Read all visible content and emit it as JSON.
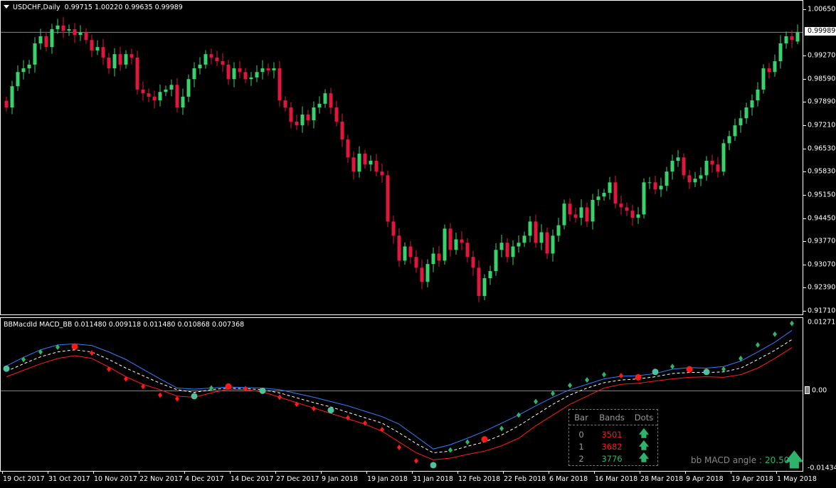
{
  "price_header": {
    "symbol": "USDCHF,Daily",
    "ohlc": "0.99715 1.00220 0.99635 0.99989"
  },
  "indicator_header": {
    "text": "BBMacdId MACD_BB 0.011480 0.009118 0.011480 0.010868 0.007368"
  },
  "price_axis": {
    "labels": [
      "1.00650",
      "0.99270",
      "0.98590",
      "0.97890",
      "0.97210",
      "0.96530",
      "0.95830",
      "0.95150",
      "0.94450",
      "0.93770",
      "0.93070",
      "0.92390",
      "0.91710"
    ],
    "current": "0.99989"
  },
  "indicator_axis": {
    "top": "0.01271",
    "zero": "0.00",
    "bottom": "-0.014341"
  },
  "time_axis": {
    "labels": [
      "19 Oct 2017",
      "31 Oct 2017",
      "10 Nov 2017",
      "22 Nov 2017",
      "4 Dec 2017",
      "14 Dec 2017",
      "27 Dec 2017",
      "9 Jan 2018",
      "19 Jan 2018",
      "31 Jan 2018",
      "12 Feb 2018",
      "22 Feb 2018",
      "6 Mar 2018",
      "16 Mar 2018",
      "28 Mar 2018",
      "9 Apr 2018",
      "19 Apr 2018",
      "1 May 2018"
    ]
  },
  "info_table": {
    "headers": [
      "Bar",
      "Bands",
      "Dots"
    ],
    "rows": [
      {
        "bar": "0",
        "bands": "3501",
        "bands_color": "#ff1a1a",
        "dots": "🡅"
      },
      {
        "bar": "1",
        "bands": "3682",
        "bands_color": "#ff1a1a",
        "dots": "🡅"
      },
      {
        "bar": "2",
        "bands": "3776",
        "bands_color": "#2fb36a",
        "dots": "🡅"
      }
    ]
  },
  "angle": {
    "label": "bb MACD angle :",
    "value": "20.50",
    "icon": "arrow-up"
  },
  "colors": {
    "bull": "#3ad16b",
    "bear": "#e0163c",
    "upper_band": "#2f7fff",
    "lower_band": "#ff1a1a",
    "middle": "#ffffff",
    "dot_up": "#2fb36a",
    "dot_down": "#ff1a1a",
    "circle_teal": "#4fc0a0",
    "circle_red": "#ff1a1a"
  },
  "chart_data": [
    {
      "type": "candlestick",
      "title": "USDCHF,Daily",
      "ylim": [
        0.9171,
        1.0065
      ],
      "last": {
        "open": 0.99715,
        "high": 1.0022,
        "low": 0.99635,
        "close": 0.99989
      },
      "close": [
        0.9776,
        0.9839,
        0.9881,
        0.9892,
        0.9903,
        0.9966,
        0.9987,
        0.9955,
        1.0008,
        1.0019,
        1.0004,
        1.0008,
        0.9991,
        0.9998,
        0.9976,
        0.9945,
        0.9955,
        0.9924,
        0.9892,
        0.9934,
        0.9903,
        0.9934,
        0.9924,
        0.9829,
        0.9818,
        0.9808,
        0.9797,
        0.9822,
        0.9829,
        0.9843,
        0.9776,
        0.9808,
        0.986,
        0.9892,
        0.9903,
        0.9934,
        0.9924,
        0.9913,
        0.9903,
        0.986,
        0.9892,
        0.9881,
        0.986,
        0.9865,
        0.9881,
        0.9892,
        0.9886,
        0.9892,
        0.9797,
        0.9776,
        0.9734,
        0.9723,
        0.9755,
        0.9738,
        0.9776,
        0.9787,
        0.9818,
        0.9776,
        0.9734,
        0.9681,
        0.9628,
        0.9586,
        0.9639,
        0.9607,
        0.9618,
        0.9586,
        0.9575,
        0.9438,
        0.9396,
        0.9322,
        0.9364,
        0.9333,
        0.9301,
        0.9259,
        0.9312,
        0.9343,
        0.9322,
        0.9417,
        0.9354,
        0.9385,
        0.9375,
        0.9333,
        0.9301,
        0.9217,
        0.927,
        0.9291,
        0.9354,
        0.9375,
        0.9333,
        0.9364,
        0.9375,
        0.9396,
        0.9438,
        0.9375,
        0.9406,
        0.9343,
        0.9396,
        0.9427,
        0.9491,
        0.9459,
        0.9449,
        0.948,
        0.9438,
        0.9502,
        0.9512,
        0.9523,
        0.9554,
        0.9491,
        0.948,
        0.947,
        0.9449,
        0.9459,
        0.9554,
        0.9554,
        0.9533,
        0.9544,
        0.9586,
        0.9618,
        0.9628,
        0.9575,
        0.9554,
        0.9565,
        0.9575,
        0.9618,
        0.9607,
        0.9586,
        0.967,
        0.9691,
        0.9723,
        0.9744,
        0.9776,
        0.9797,
        0.9829,
        0.9892,
        0.9881,
        0.9913,
        0.9966,
        0.9987,
        0.9976,
        0.99989
      ]
    },
    {
      "type": "line",
      "title": "BBMacdId MACD_BB",
      "ylim": [
        -0.014341,
        0.01271
      ],
      "macd": [
        0.0041,
        0.0058,
        0.0072,
        0.0081,
        0.0082,
        0.007,
        0.004,
        0.0022,
        0.0008,
        -0.0008,
        -0.0015,
        -0.001,
        0.0005,
        0.0008,
        0.0004,
        0.0,
        -0.0012,
        -0.0025,
        -0.0033,
        -0.0036,
        -0.005,
        -0.006,
        -0.0072,
        -0.0105,
        -0.013,
        -0.0138,
        -0.011,
        -0.0095,
        -0.009,
        -0.007,
        -0.0045,
        -0.002,
        -0.0005,
        0.001,
        0.002,
        0.003,
        0.0028,
        0.0025,
        0.0035,
        0.0045,
        0.004,
        0.0035,
        0.004,
        0.006,
        0.0085,
        0.0105,
        0.0125
      ],
      "upper": [
        0.0046,
        0.0062,
        0.0076,
        0.0085,
        0.0087,
        0.0084,
        0.0072,
        0.0058,
        0.004,
        0.0022,
        0.0005,
        0.0003,
        0.0005,
        0.0007,
        0.0006,
        0.0005,
        0.0002,
        -0.0005,
        -0.0012,
        -0.002,
        -0.0028,
        -0.0038,
        -0.0048,
        -0.0062,
        -0.0085,
        -0.0108,
        -0.01,
        -0.0088,
        -0.0075,
        -0.006,
        -0.0045,
        -0.0028,
        -0.0012,
        0.0002,
        0.0012,
        0.0022,
        0.0027,
        0.0028,
        0.0032,
        0.004,
        0.0043,
        0.0042,
        0.0045,
        0.0055,
        0.0072,
        0.009,
        0.0112
      ],
      "middle": [
        0.0036,
        0.005,
        0.0063,
        0.0072,
        0.0076,
        0.0072,
        0.0058,
        0.0042,
        0.0028,
        0.0014,
        0.0002,
        -0.0003,
        0.0002,
        0.0005,
        0.0004,
        0.0002,
        -0.0004,
        -0.0013,
        -0.0022,
        -0.003,
        -0.004,
        -0.005,
        -0.006,
        -0.0078,
        -0.0098,
        -0.0115,
        -0.0112,
        -0.0103,
        -0.0095,
        -0.0082,
        -0.0065,
        -0.0045,
        -0.0025,
        -0.0008,
        0.0005,
        0.0015,
        0.002,
        0.0022,
        0.0026,
        0.0032,
        0.0034,
        0.0034,
        0.0035,
        0.0042,
        0.0058,
        0.0075,
        0.0095
      ],
      "lower": [
        0.0026,
        0.0038,
        0.005,
        0.006,
        0.0065,
        0.006,
        0.0044,
        0.0026,
        0.0012,
        0.0002,
        -0.001,
        -0.0012,
        -0.0004,
        0.0003,
        0.0002,
        -0.0002,
        -0.0012,
        -0.0022,
        -0.0032,
        -0.0042,
        -0.0052,
        -0.0062,
        -0.0075,
        -0.0095,
        -0.0115,
        -0.0128,
        -0.0125,
        -0.0118,
        -0.0112,
        -0.0102,
        -0.0088,
        -0.0065,
        -0.0045,
        -0.0025,
        -0.001,
        0.0005,
        0.0012,
        0.0014,
        0.0018,
        0.0022,
        0.0025,
        0.0026,
        0.0025,
        0.003,
        0.0042,
        0.006,
        0.008
      ],
      "signals": [
        {
          "i": 0,
          "c": "teal"
        },
        {
          "i": 4,
          "c": "red"
        },
        {
          "i": 11,
          "c": "teal"
        },
        {
          "i": 13,
          "c": "red"
        },
        {
          "i": 15,
          "c": "teal"
        },
        {
          "i": 19,
          "c": "teal"
        },
        {
          "i": 25,
          "c": "teal"
        },
        {
          "i": 28,
          "c": "red"
        },
        {
          "i": 37,
          "c": "red"
        },
        {
          "i": 38,
          "c": "teal"
        },
        {
          "i": 40,
          "c": "red"
        },
        {
          "i": 41,
          "c": "teal"
        }
      ]
    }
  ]
}
